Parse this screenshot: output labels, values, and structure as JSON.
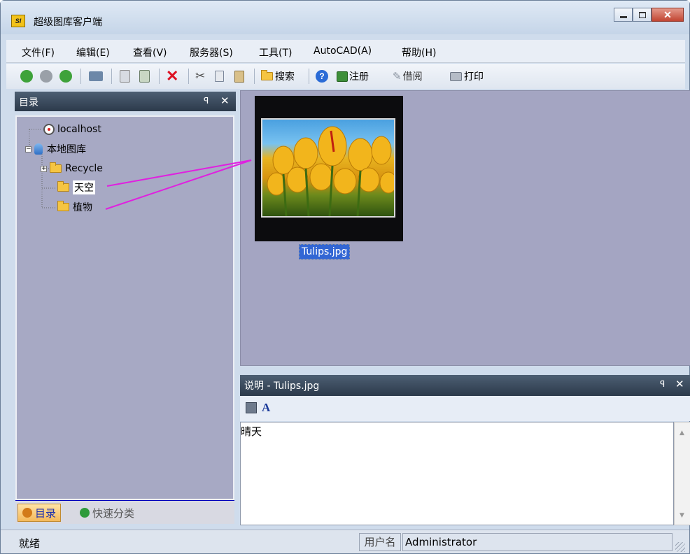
{
  "window": {
    "title": "超级图库客户端",
    "app_icon_text": "SI"
  },
  "menu": [
    {
      "label": "文件(F)"
    },
    {
      "label": "编辑(E)"
    },
    {
      "label": "查看(V)"
    },
    {
      "label": "服务器(S)"
    },
    {
      "label": "工具(T)"
    },
    {
      "label": "AutoCAD(A)"
    },
    {
      "label": "帮助(H)"
    }
  ],
  "toolbar": {
    "search_label": "搜索",
    "register_label": "注册",
    "borrow_label": "借阅",
    "print_label": "打印"
  },
  "tree_pane": {
    "title": "目录",
    "nodes": [
      {
        "label": "localhost"
      },
      {
        "label": "本地图库"
      },
      {
        "label": "Recycle"
      },
      {
        "label": "天空"
      },
      {
        "label": "植物"
      }
    ]
  },
  "bottom_tabs": [
    {
      "label": "目录"
    },
    {
      "label": "快速分类"
    }
  ],
  "gallery": {
    "items": [
      {
        "filename": "Tulips.jpg"
      }
    ]
  },
  "description_pane": {
    "title": "说明 - Tulips.jpg",
    "text": "晴天",
    "font_button_label": "A"
  },
  "statusbar": {
    "status": "就绪",
    "user_label": "用户名",
    "user_value": "Administrator"
  },
  "colors": {
    "annotation_line": "#e020e0",
    "selection": "#3266d4",
    "pane_header": "#2c3a4b"
  }
}
